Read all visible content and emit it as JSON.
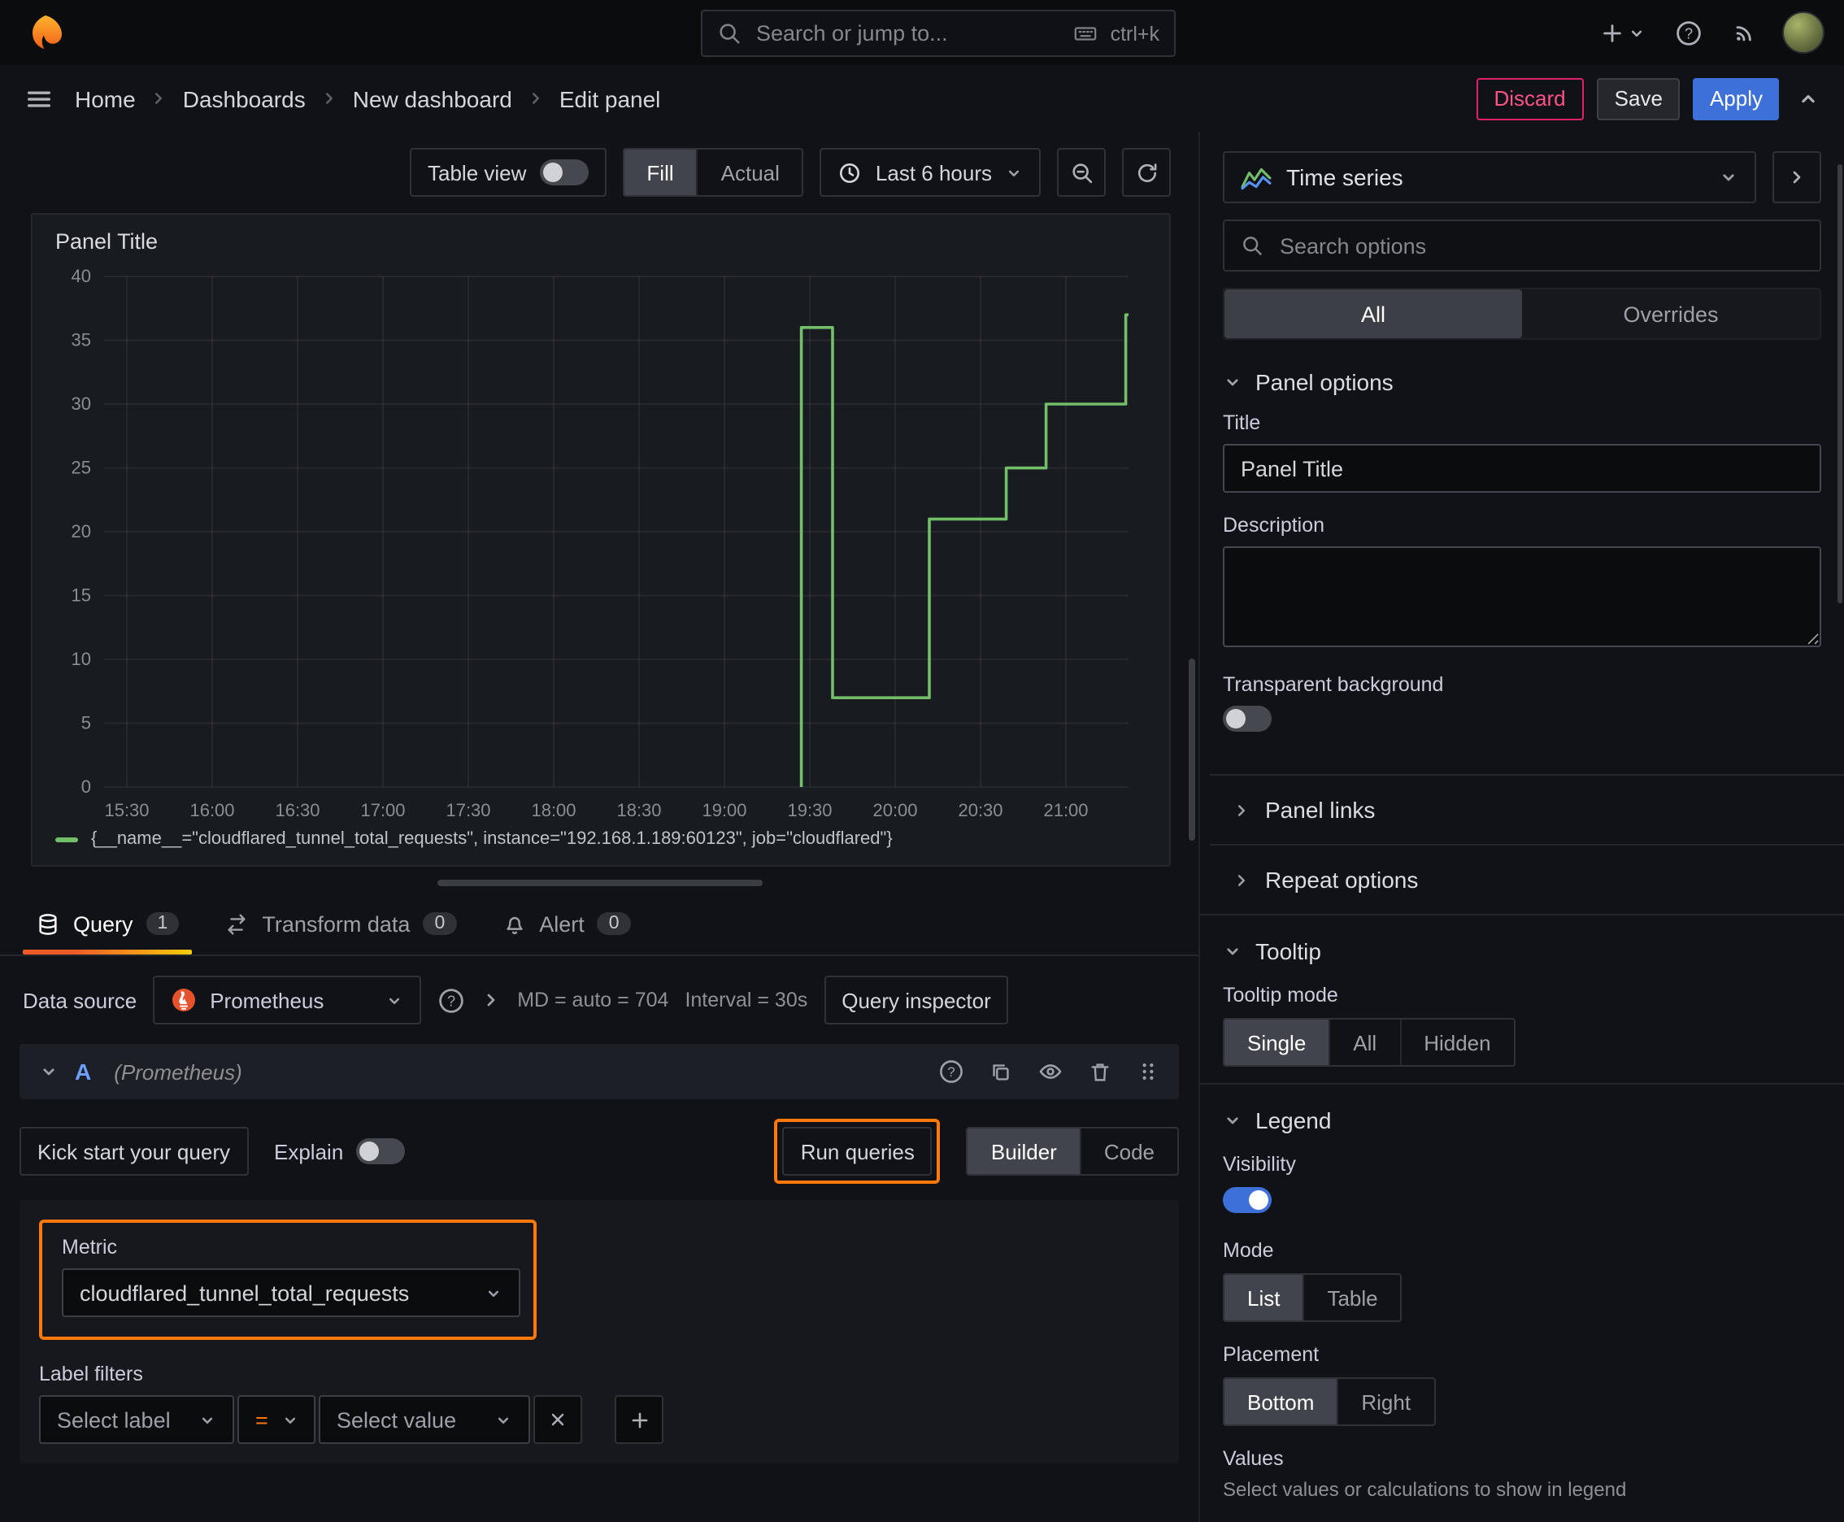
{
  "topbar": {
    "search_placeholder": "Search or jump to...",
    "shortcut": "ctrl+k"
  },
  "breadcrumb": {
    "items": [
      "Home",
      "Dashboards",
      "New dashboard",
      "Edit panel"
    ]
  },
  "actions": {
    "discard": "Discard",
    "save": "Save",
    "apply": "Apply"
  },
  "viz_toolbar": {
    "table_view": "Table view",
    "fill": "Fill",
    "actual": "Actual",
    "time_range": "Last 6 hours"
  },
  "panel": {
    "title": "Panel Title"
  },
  "chart_data": {
    "type": "line",
    "title": "Panel Title",
    "x_range_minutes": [
      922,
      1282
    ],
    "x_ticks": [
      {
        "t": 930,
        "label": "15:30"
      },
      {
        "t": 960,
        "label": "16:00"
      },
      {
        "t": 990,
        "label": "16:30"
      },
      {
        "t": 1020,
        "label": "17:00"
      },
      {
        "t": 1050,
        "label": "17:30"
      },
      {
        "t": 1080,
        "label": "18:00"
      },
      {
        "t": 1110,
        "label": "18:30"
      },
      {
        "t": 1140,
        "label": "19:00"
      },
      {
        "t": 1170,
        "label": "19:30"
      },
      {
        "t": 1200,
        "label": "20:00"
      },
      {
        "t": 1230,
        "label": "20:30"
      },
      {
        "t": 1260,
        "label": "21:00"
      }
    ],
    "ylim": [
      0,
      40
    ],
    "y_ticks": [
      0,
      5,
      10,
      15,
      20,
      25,
      30,
      35,
      40
    ],
    "grid": true,
    "legend_position": "bottom",
    "series": [
      {
        "name": "{__name__=\"cloudflared_tunnel_total_requests\", instance=\"192.168.1.189:60123\", job=\"cloudflared\"}",
        "color": "#73bf69",
        "points": [
          [
            1167,
            0
          ],
          [
            1167,
            36
          ],
          [
            1178,
            36
          ],
          [
            1178,
            7
          ],
          [
            1212,
            7
          ],
          [
            1212,
            21
          ],
          [
            1239,
            21
          ],
          [
            1239,
            25
          ],
          [
            1253,
            25
          ],
          [
            1253,
            30
          ],
          [
            1281,
            30
          ],
          [
            1281,
            37
          ],
          [
            1282,
            37
          ]
        ]
      }
    ]
  },
  "query_tabs": {
    "query": "Query",
    "query_count": "1",
    "transform": "Transform data",
    "transform_count": "0",
    "alert": "Alert",
    "alert_count": "0"
  },
  "datasource_row": {
    "label": "Data source",
    "name": "Prometheus",
    "max_data_points": "MD = auto = 704",
    "interval": "Interval = 30s",
    "inspector": "Query inspector"
  },
  "query_editor": {
    "ref_id": "A",
    "ds_hint": "(Prometheus)",
    "kick_start": "Kick start your query",
    "explain": "Explain",
    "run_queries": "Run queries",
    "builder": "Builder",
    "code": "Code",
    "metric_label": "Metric",
    "metric_value": "cloudflared_tunnel_total_requests",
    "label_filters_label": "Label filters",
    "select_label": "Select label",
    "operator": "=",
    "select_value": "Select value"
  },
  "sidebar": {
    "visualization": "Time series",
    "search_placeholder": "Search options",
    "tab_all": "All",
    "tab_overrides": "Overrides",
    "panel_options": {
      "heading": "Panel options",
      "title_label": "Title",
      "title_value": "Panel Title",
      "description_label": "Description",
      "transparent_label": "Transparent background",
      "panel_links": "Panel links",
      "repeat_options": "Repeat options"
    },
    "tooltip": {
      "heading": "Tooltip",
      "mode_label": "Tooltip mode",
      "options": [
        "Single",
        "All",
        "Hidden"
      ],
      "selected": "Single"
    },
    "legend": {
      "heading": "Legend",
      "visibility_label": "Visibility",
      "mode_label": "Mode",
      "mode_options": [
        "List",
        "Table"
      ],
      "mode_selected": "List",
      "placement_label": "Placement",
      "placement_options": [
        "Bottom",
        "Right"
      ],
      "placement_selected": "Bottom",
      "values_label": "Values",
      "values_hint": "Select values or calculations to show in legend"
    }
  },
  "colors": {
    "accent_orange": "#ff780a",
    "series_green": "#73bf69",
    "primary_blue": "#3d71d9",
    "danger_pink": "#ff5286"
  }
}
